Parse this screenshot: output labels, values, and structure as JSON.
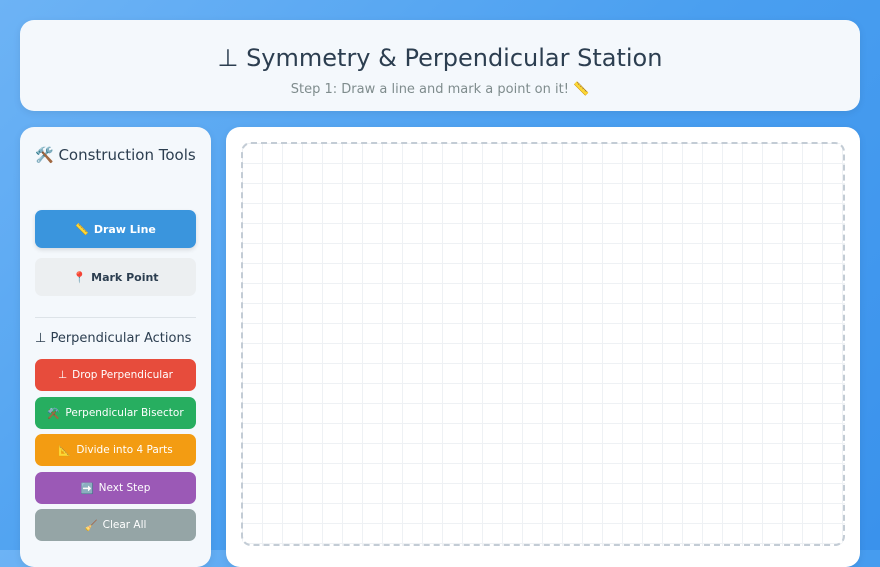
{
  "header": {
    "title": "⊥ Symmetry & Perpendicular Station",
    "subtitle": "Step 1: Draw a line and mark a point on it! 📏"
  },
  "sidebar": {
    "tools_heading": "🛠️ Construction Tools",
    "draw_line": {
      "icon": "📏",
      "label": "Draw Line"
    },
    "mark_point": {
      "icon": "📍",
      "label": "Mark Point"
    },
    "actions_heading": "⊥ Perpendicular Actions",
    "actions": [
      {
        "icon": "⊥",
        "label": "Drop Perpendicular"
      },
      {
        "icon": "⚒️",
        "label": "Perpendicular Bisector"
      },
      {
        "icon": "📐",
        "label": "Divide into 4 Parts"
      },
      {
        "icon": "➡️",
        "label": "Next Step"
      },
      {
        "icon": "🧹",
        "label": "Clear All"
      }
    ]
  },
  "colors": {
    "draw_line": "#3a95dd",
    "drop": "#e74c3c",
    "bisector": "#27ae60",
    "divide": "#f39c12",
    "next": "#9b59b6",
    "clear": "#95a5a6"
  }
}
